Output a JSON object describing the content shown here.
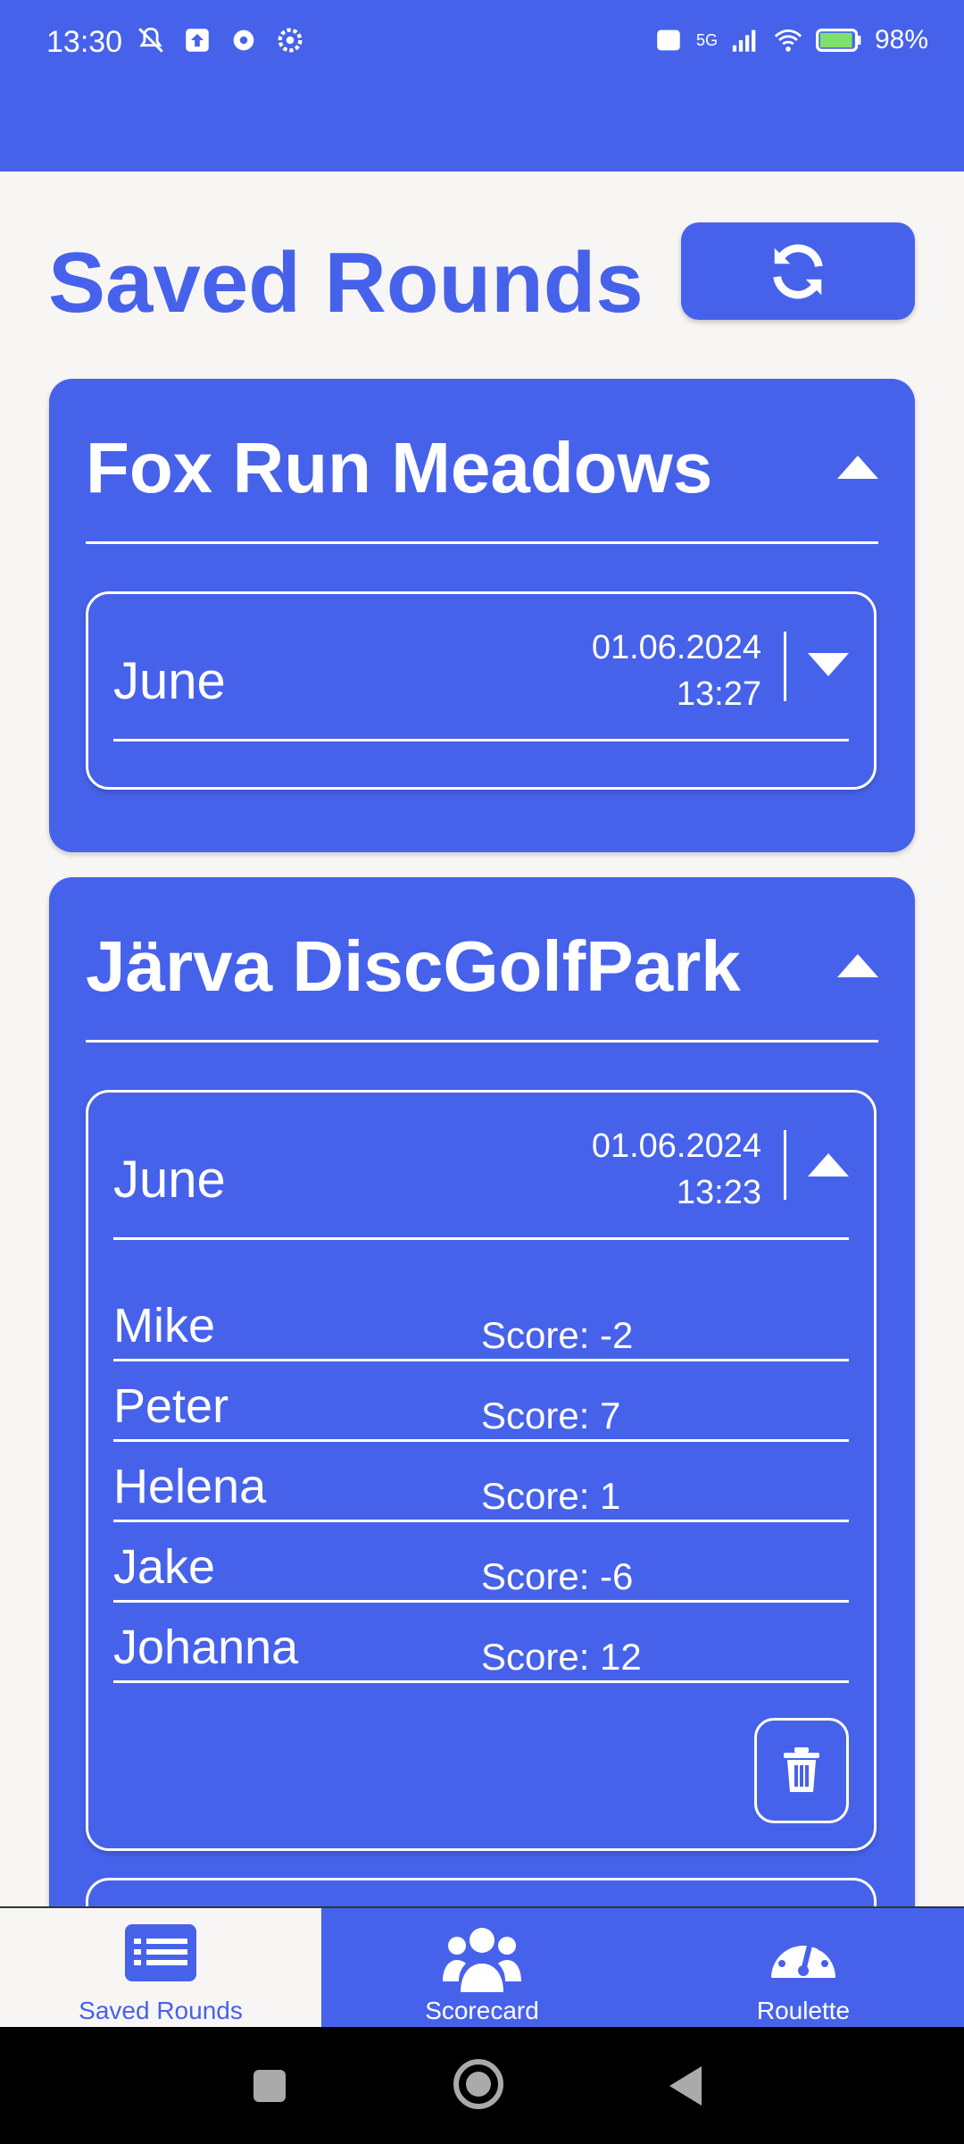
{
  "status_bar": {
    "time": "13:30",
    "battery": "98%",
    "network": "5G",
    "icons": [
      "mute-icon",
      "upload-icon",
      "settings-icon",
      "settings-gear-icon",
      "volte-icon",
      "signal-icon",
      "wifi-icon",
      "battery-icon"
    ]
  },
  "header": {
    "title": "Saved Rounds",
    "refresh_icon": "refresh-icon"
  },
  "courses": [
    {
      "name": "Fox Run Meadows",
      "expanded": true,
      "rounds": [
        {
          "name": "June",
          "date": "01.06.2024",
          "time": "13:27",
          "expanded": false,
          "players": []
        }
      ]
    },
    {
      "name": "Järva DiscGolfPark",
      "expanded": true,
      "rounds": [
        {
          "name": "June",
          "date": "01.06.2024",
          "time": "13:23",
          "expanded": true,
          "players": [
            {
              "name": "Mike",
              "score": "Score: -2"
            },
            {
              "name": "Peter",
              "score": "Score: 7"
            },
            {
              "name": "Helena",
              "score": "Score: 1"
            },
            {
              "name": "Jake",
              "score": "Score: -6"
            },
            {
              "name": "Johanna",
              "score": "Score: 12"
            }
          ]
        }
      ]
    }
  ],
  "bottom_nav": [
    {
      "label": "Saved Rounds",
      "icon": "list-icon",
      "active": true
    },
    {
      "label": "Scorecard",
      "icon": "group-icon",
      "active": false
    },
    {
      "label": "Roulette",
      "icon": "gauge-icon",
      "active": false
    }
  ],
  "colors": {
    "primary": "#4762ea",
    "background": "#f8f6f4",
    "on_primary": "#ffffff"
  }
}
